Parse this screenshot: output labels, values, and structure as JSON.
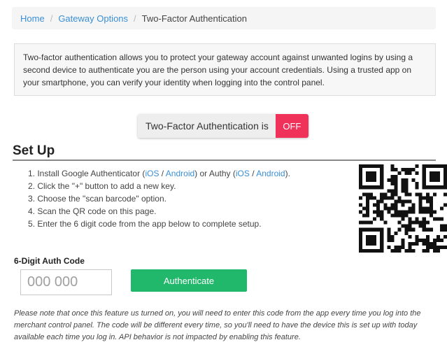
{
  "breadcrumb": {
    "home": "Home",
    "gateway_options": "Gateway Options",
    "current": "Two-Factor Authentication",
    "separator": "/"
  },
  "info": {
    "text": "Two-factor authentication allows you to protect your gateway account against unwanted logins by using a second device to authenticate you are the person using your account credentials. Using a trusted app on your smartphone, you can verify your identity when logging into the control panel."
  },
  "toggle": {
    "label": "Two-Factor Authentication is",
    "state": "OFF"
  },
  "setup": {
    "title": "Set Up",
    "steps": {
      "s1_prefix": "1. Install Google Authenticator (",
      "s1_ios": "iOS",
      "s1_slash": " / ",
      "s1_android": "Android",
      "s1_mid": ") or Authy (",
      "s1_ios2": "iOS",
      "s1_slash2": " / ",
      "s1_android2": "Android",
      "s1_end": ").",
      "s2": "2. Click the \"+\" button to add a new key.",
      "s3": "3. Choose the \"scan barcode\" option.",
      "s4": "4. Scan the QR code on this page.",
      "s5": "5. Enter the 6 digit code from the app below to complete setup."
    }
  },
  "auth": {
    "label": "6-Digit Auth Code",
    "placeholder": "000 000",
    "button": "Authenticate"
  },
  "note": "Please note that once this feature us turned on, you will need to enter this code from the app every time you log into the merchant control panel. The code will be different every time, so you'll need to have the device this is set up with today available each time you log in. API behavior is not impacted by enabling this feature.",
  "colors": {
    "link": "#3a8fd6",
    "off_toggle": "#f0325a",
    "authenticate": "#22b86c"
  }
}
